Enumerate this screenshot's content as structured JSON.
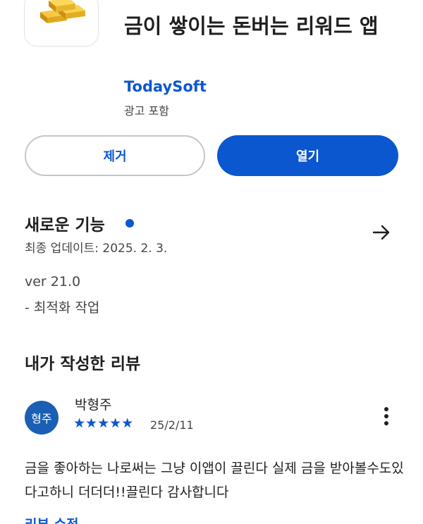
{
  "app": {
    "title": "금이 쌓이는 돈버는 리워드 앱",
    "developer": "TodaySoft",
    "ad_label": "광고 포함",
    "icon": "gold-bars-icon"
  },
  "actions": {
    "remove_label": "제거",
    "open_label": "열기"
  },
  "whats_new": {
    "title": "새로운 기능",
    "updated": "최종 업데이트: 2025. 2. 3.",
    "version": "ver 21.0",
    "note": "- 최적화 작업"
  },
  "my_review": {
    "heading": "내가 작성한 리뷰",
    "avatar_text": "형주",
    "reviewer": "박형주",
    "stars": "★★★★★",
    "rating": 5,
    "date": "25/2/11",
    "text": "금을 좋아하는 나로써는 그냥 이앱이 끌린다 실제 금을 받아볼수도있다고하니 더더더!!끌린다 감사합니다",
    "edit_label": "리뷰 수정"
  },
  "colors": {
    "accent": "#0b57d0",
    "avatar": "#1a5fb4"
  }
}
